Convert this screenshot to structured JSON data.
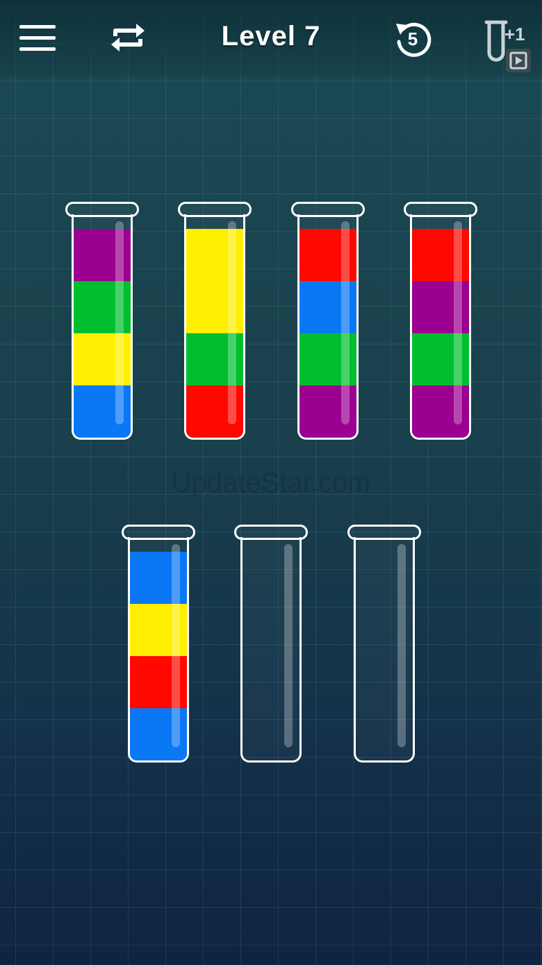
{
  "header": {
    "level_label": "Level 7",
    "undo_count": "5",
    "add_tube_label": "+1"
  },
  "watermark": "UpdateStar.com",
  "colors": {
    "purple": "#9b0091",
    "green": "#00bf2e",
    "yellow": "#ffef00",
    "blue": "#0a78f5",
    "red": "#ff0800"
  },
  "capacity": 4,
  "tubes": [
    {
      "layers_bottom_to_top": [
        "blue",
        "yellow",
        "green",
        "purple"
      ]
    },
    {
      "layers_bottom_to_top": [
        "red",
        "green",
        "yellow",
        "yellow"
      ]
    },
    {
      "layers_bottom_to_top": [
        "purple",
        "green",
        "blue",
        "red"
      ]
    },
    {
      "layers_bottom_to_top": [
        "purple",
        "green",
        "purple",
        "red"
      ]
    },
    {
      "layers_bottom_to_top": [
        "blue",
        "red",
        "yellow",
        "blue"
      ]
    },
    {
      "layers_bottom_to_top": []
    },
    {
      "layers_bottom_to_top": []
    }
  ]
}
